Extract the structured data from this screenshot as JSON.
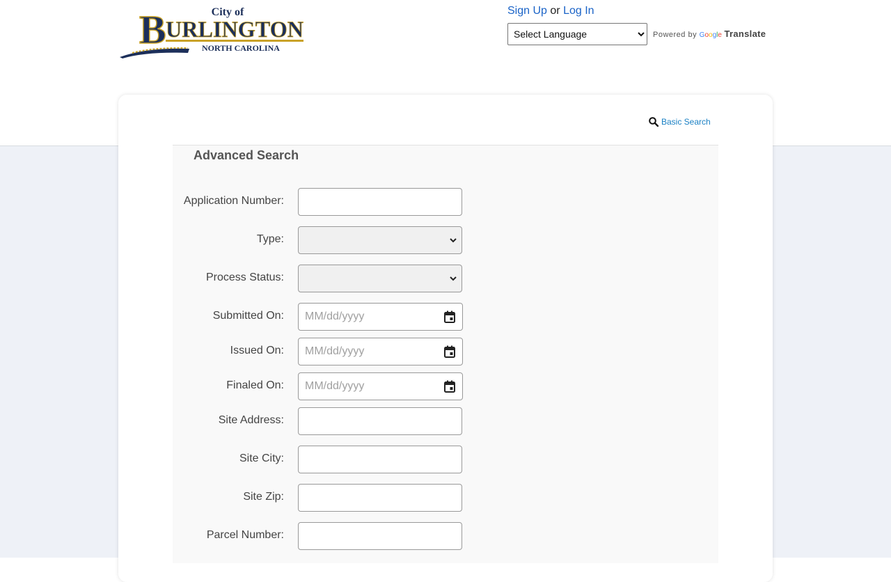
{
  "header": {
    "logo": {
      "top_text": "City of",
      "main_text": "BURLINGTON",
      "sub_text": "NORTH CAROLINA"
    },
    "sign_up": "Sign Up",
    "or": "or",
    "log_in": "Log In",
    "language_select": "Select Language",
    "powered_by": "Powered by",
    "google": "Google",
    "translate": "Translate"
  },
  "search": {
    "basic_search_link": "Basic Search",
    "panel_title": "Advanced Search",
    "fields": {
      "application_number": {
        "label": "Application Number:",
        "value": ""
      },
      "type": {
        "label": "Type:",
        "value": ""
      },
      "process_status": {
        "label": "Process Status:",
        "value": ""
      },
      "submitted_on": {
        "label": "Submitted On:",
        "placeholder": "MM/dd/yyyy"
      },
      "issued_on": {
        "label": "Issued On:",
        "placeholder": "MM/dd/yyyy"
      },
      "finaled_on": {
        "label": "Finaled On:",
        "placeholder": "MM/dd/yyyy"
      },
      "site_address": {
        "label": "Site Address:",
        "value": ""
      },
      "site_city": {
        "label": "Site City:",
        "value": ""
      },
      "site_zip": {
        "label": "Site Zip:",
        "value": ""
      },
      "parcel_number": {
        "label": "Parcel Number:",
        "value": ""
      }
    }
  },
  "colors": {
    "link": "#1a63c7",
    "accent_link": "#1a80c4",
    "logo_navy": "#1c2f5a",
    "logo_gold": "#c9a227",
    "band": "#eef1f7"
  },
  "icons": {
    "search": "search-icon",
    "calendar": "calendar-icon",
    "chevron": "chevron-down-icon"
  }
}
